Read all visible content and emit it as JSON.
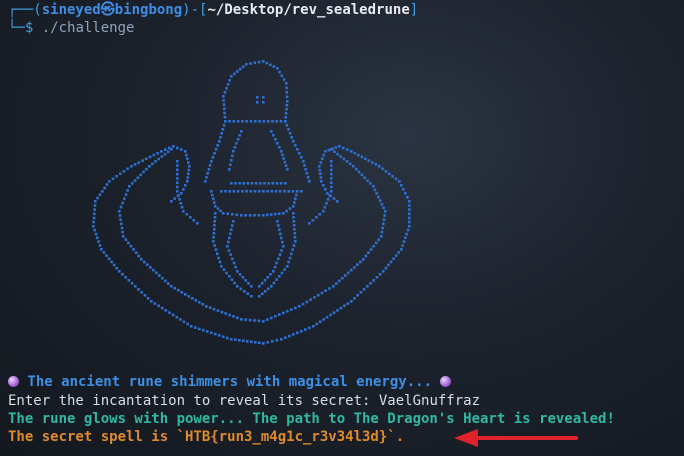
{
  "prompt": {
    "open": "┌──(",
    "user": "sineyed",
    "at": "㉿",
    "host": "bingbong",
    "mid": ")-[",
    "path": "~/Desktop/rev_sealedrune",
    "close": "]",
    "line2_prefix": "└─",
    "dollar": "$",
    "command": "./challenge"
  },
  "output": {
    "rune_msg": " The ancient rune shimmers with magical energy... ",
    "incantation_prompt": "Enter the incantation to reveal its secret: ",
    "incantation_value": "VaelGnuffraz",
    "glow_msg": "The rune glows with power... The path to The Dragon's Heart is revealed!",
    "secret_msg": "The secret spell is `HTB{run3_m4g1c_r3v34l3d}`."
  },
  "colors": {
    "ascii_art": "#2e6fd0",
    "annotation_arrow": "#e1222b"
  },
  "icons": [
    "crystal-ball-icon",
    "crystal-ball-icon"
  ]
}
